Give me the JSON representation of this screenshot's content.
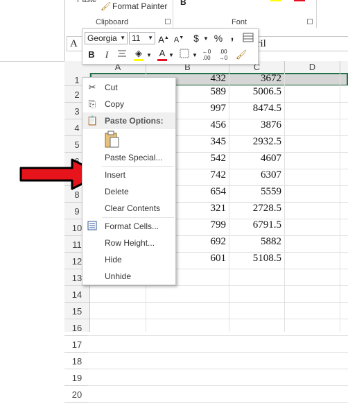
{
  "ribbon": {
    "format_painter": "Format Painter",
    "clipboard_group": "Clipboard",
    "font_group": "Font"
  },
  "name_box": "A",
  "formula_partial": "pril",
  "columns": [
    "A",
    "B",
    "C",
    "D"
  ],
  "rows": [
    "1",
    "2",
    "3",
    "4",
    "5",
    "6",
    "7",
    "8",
    "9",
    "10",
    "11",
    "12",
    "13",
    "14",
    "15",
    "16",
    "17",
    "18",
    "19",
    "20"
  ],
  "data_rows": [
    {
      "b": "432",
      "c": "3672"
    },
    {
      "b": "589",
      "c": "5006.5"
    },
    {
      "b": "997",
      "c": "8474.5"
    },
    {
      "b": "456",
      "c": "3876"
    },
    {
      "b": "345",
      "c": "2932.5"
    },
    {
      "b": "542",
      "c": "4607"
    },
    {
      "b": "742",
      "c": "6307"
    },
    {
      "b": "654",
      "c": "5559"
    },
    {
      "b": "321",
      "c": "2728.5"
    },
    {
      "b": "799",
      "c": "6791.5"
    },
    {
      "b": "692",
      "c": "5882"
    },
    {
      "b": "601",
      "c": "5108.5"
    }
  ],
  "mini_toolbar": {
    "font": "Georgia",
    "size": "11",
    "bold": "B",
    "italic": "I",
    "percent": "%",
    "dollar": "$",
    "comma": ","
  },
  "context_menu": {
    "cut": "Cut",
    "copy": "Copy",
    "paste_options": "Paste Options:",
    "paste_special": "Paste Special...",
    "insert": "Insert",
    "delete": "Delete",
    "clear_contents": "Clear Contents",
    "format_cells": "Format Cells...",
    "row_height": "Row Height...",
    "hide": "Hide",
    "unhide": "Unhide"
  },
  "colors": {
    "selection_border": "#217346",
    "arrow_red": "#e8141b",
    "font_red": "#e81123",
    "highlight_yellow": "#ffff00"
  }
}
